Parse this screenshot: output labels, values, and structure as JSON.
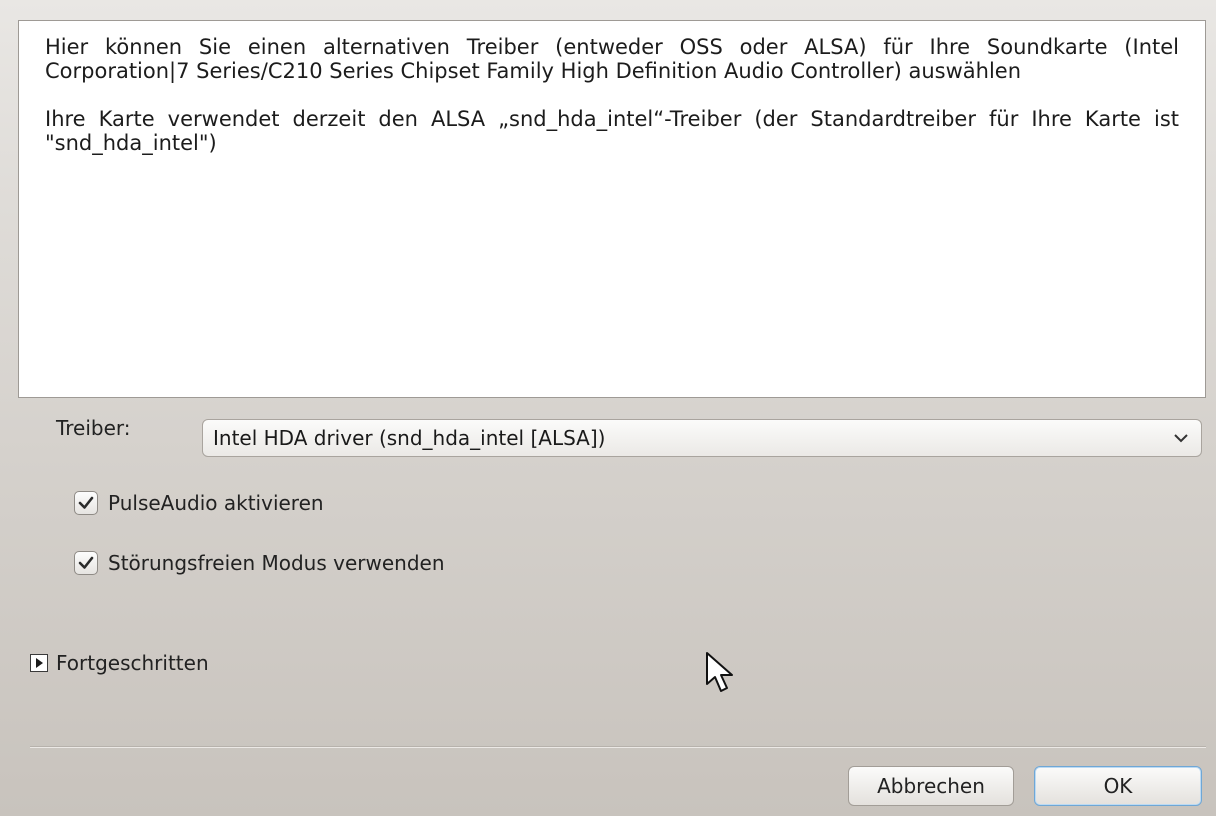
{
  "info": {
    "paragraph1": "Hier können Sie einen alternativen Treiber (entweder OSS oder ALSA) für Ihre Soundkarte (Intel Corporation|7 Series/C210 Series Chipset Family High Definition Audio Controller) auswählen",
    "paragraph2": "Ihre Karte verwendet derzeit den ALSA „snd_hda_intel“-Treiber (der Standardtreiber für Ihre Karte ist \"snd_hda_intel\")"
  },
  "driver": {
    "label": "Treiber:",
    "selected": "Intel HDA driver (snd_hda_intel [ALSA])",
    "icon": "chevron-down-icon"
  },
  "options": {
    "pulseaudio": {
      "label": "PulseAudio aktivieren",
      "checked": true
    },
    "glitchfree": {
      "label": "Störungsfreien Modus verwenden",
      "checked": true
    }
  },
  "advanced": {
    "label": "Fortgeschritten",
    "icon": "expander-arrow-icon",
    "expanded": false
  },
  "buttons": {
    "cancel": "Abbrechen",
    "ok": "OK"
  },
  "colors": {
    "focus_accent": "#6fa7d6",
    "checkmark": "#2b2b2b"
  }
}
